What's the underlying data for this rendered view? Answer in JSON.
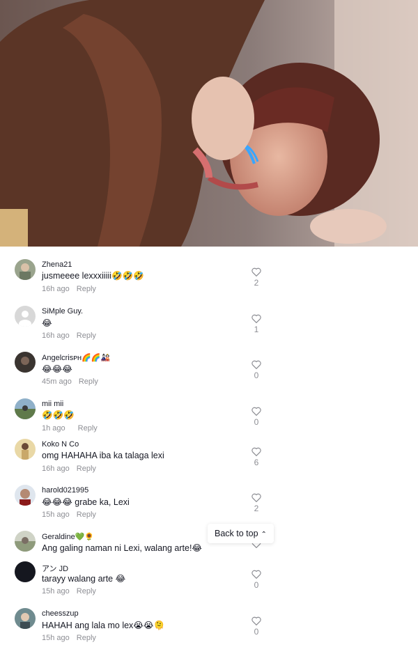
{
  "video": {
    "description_icon": "video-frame"
  },
  "back_to_top": {
    "label": "Back to top",
    "icon": "double-chevron-up-icon"
  },
  "comments": [
    {
      "username": "Zhena21",
      "text": "jusmeeee lexxxiiiii🤣🤣🤣",
      "time": "16h ago",
      "reply": "Reply",
      "likes": "2",
      "avatar_color": "#9aa48d"
    },
    {
      "username": "SiMple Guy.",
      "text": "😂",
      "time": "16h ago",
      "reply": "Reply",
      "likes": "1",
      "avatar_color": "#d8d8d8"
    },
    {
      "username": "Angelcrisᴘʜ🌈🌈🎎",
      "text": "😂😂😂",
      "time": "45m ago",
      "reply": "Reply",
      "likes": "0",
      "avatar_color": "#3a3430"
    },
    {
      "username": "mii mii",
      "text": "🤣🤣🤣",
      "time": "1h ago",
      "reply": "Reply",
      "likes": "0",
      "avatar_color": "#5f7a4a"
    },
    {
      "username": "Koko N Co",
      "text": "omg HAHAHA iba ka talaga lexi",
      "time": "16h ago",
      "reply": "Reply",
      "likes": "6",
      "avatar_color": "#c9a86a"
    },
    {
      "username": "harold021995",
      "text": "😂😂😂 grabe ka, Lexi",
      "time": "15h ago",
      "reply": "Reply",
      "likes": "2",
      "avatar_color": "#b48a73"
    },
    {
      "username": "Geraldine💚🌻",
      "text": "Ang galing naman ni Lexi, walang arte!😂",
      "time": "",
      "reply": "",
      "likes": "",
      "avatar_color": "#a9b1a0"
    },
    {
      "username": "アン JD",
      "text": "tarayy walang arte 😂",
      "time": "15h ago",
      "reply": "Reply",
      "likes": "0",
      "avatar_color": "#15171f"
    },
    {
      "username": "cheesszup",
      "text": "HAHAH ang lala mo lex😭😭🫠",
      "time": "15h ago",
      "reply": "Reply",
      "likes": "0",
      "avatar_color": "#6f8b8f"
    }
  ]
}
